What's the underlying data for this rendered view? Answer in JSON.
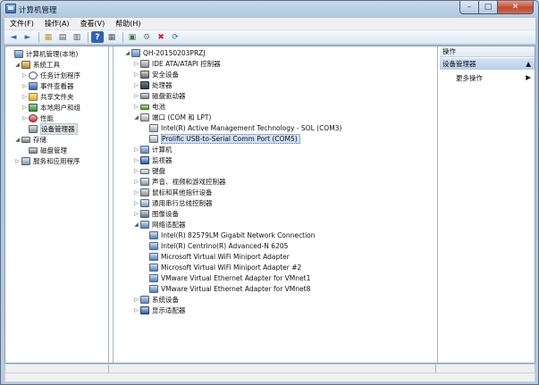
{
  "window": {
    "title": "计算机管理",
    "min": "–",
    "max": "□",
    "close": "✕"
  },
  "menu": [
    "文件(F)",
    "操作(A)",
    "查看(V)",
    "帮助(H)"
  ],
  "toolbar": [
    "◄",
    "►",
    "▦",
    "▤",
    "▥",
    "?",
    "▦",
    "▣",
    "⚙",
    "✖",
    "⟳"
  ],
  "left_tree": [
    {
      "label": "计算机管理(本地)",
      "icon": "computer-icon",
      "exp": "",
      "indent": 0
    },
    {
      "label": "系统工具",
      "icon": "tools-icon",
      "exp": "◢",
      "indent": 1
    },
    {
      "label": "任务计划程序",
      "icon": "clock-icon",
      "exp": "▷",
      "indent": 2
    },
    {
      "label": "事件查看器",
      "icon": "book-icon",
      "exp": "▷",
      "indent": 2
    },
    {
      "label": "共享文件夹",
      "icon": "folder-icon",
      "exp": "▷",
      "indent": 2
    },
    {
      "label": "本地用户和组",
      "icon": "users-icon",
      "exp": "▷",
      "indent": 2
    },
    {
      "label": "性能",
      "icon": "performance-icon",
      "exp": "▷",
      "indent": 2
    },
    {
      "label": "设备管理器",
      "icon": "device-manager-icon",
      "exp": "",
      "indent": 2,
      "selected": true
    },
    {
      "label": "存储",
      "icon": "storage-icon",
      "exp": "◢",
      "indent": 1
    },
    {
      "label": "磁盘管理",
      "icon": "disk-icon",
      "exp": "",
      "indent": 2
    },
    {
      "label": "服务和应用程序",
      "icon": "services-icon",
      "exp": "▷",
      "indent": 1
    }
  ],
  "device_tree": [
    {
      "label": "QH-20150203PRZJ",
      "icon": "computer-icon",
      "exp": "◢",
      "indent": 0
    },
    {
      "label": "IDE ATA/ATAPI 控制器",
      "icon": "ide-icon",
      "exp": "▷",
      "indent": 1
    },
    {
      "label": "安全设备",
      "icon": "security-icon",
      "exp": "▷",
      "indent": 1
    },
    {
      "label": "处理器",
      "icon": "processor-icon",
      "exp": "▷",
      "indent": 1
    },
    {
      "label": "磁盘驱动器",
      "icon": "disk-drive-icon",
      "exp": "▷",
      "indent": 1
    },
    {
      "label": "电池",
      "icon": "battery-icon",
      "exp": "▷",
      "indent": 1
    },
    {
      "label": "端口 (COM 和 LPT)",
      "icon": "port-icon",
      "exp": "◢",
      "indent": 1
    },
    {
      "label": "Intel(R) Active Management Technology - SOL (COM3)",
      "icon": "port-icon",
      "exp": "",
      "indent": 2
    },
    {
      "label": "Prolific USB-to-Serial Comm Port (COM5)",
      "icon": "port-icon",
      "exp": "",
      "indent": 2,
      "selected": true
    },
    {
      "label": "计算机",
      "icon": "computer-icon",
      "exp": "▷",
      "indent": 1
    },
    {
      "label": "监视器",
      "icon": "monitor-icon",
      "exp": "▷",
      "indent": 1
    },
    {
      "label": "键盘",
      "icon": "keyboard-icon",
      "exp": "▷",
      "indent": 1
    },
    {
      "label": "声音、视频和游戏控制器",
      "icon": "sound-icon",
      "exp": "▷",
      "indent": 1
    },
    {
      "label": "鼠标和其他指针设备",
      "icon": "mouse-icon",
      "exp": "▷",
      "indent": 1
    },
    {
      "label": "通用串行总线控制器",
      "icon": "usb-icon",
      "exp": "▷",
      "indent": 1
    },
    {
      "label": "图像设备",
      "icon": "imaging-icon",
      "exp": "▷",
      "indent": 1
    },
    {
      "label": "网络适配器",
      "icon": "network-icon",
      "exp": "◢",
      "indent": 1
    },
    {
      "label": "Intel(R) 82579LM Gigabit Network Connection",
      "icon": "network-icon",
      "exp": "",
      "indent": 2
    },
    {
      "label": "Intel(R) Centrino(R) Advanced-N 6205",
      "icon": "network-icon",
      "exp": "",
      "indent": 2
    },
    {
      "label": "Microsoft Virtual WiFi Miniport Adapter",
      "icon": "network-icon",
      "exp": "",
      "indent": 2
    },
    {
      "label": "Microsoft Virtual WiFi Miniport Adapter #2",
      "icon": "network-icon",
      "exp": "",
      "indent": 2
    },
    {
      "label": "VMware Virtual Ethernet Adapter for VMnet1",
      "icon": "network-icon",
      "exp": "",
      "indent": 2
    },
    {
      "label": "VMware Virtual Ethernet Adapter for VMnet8",
      "icon": "network-icon",
      "exp": "",
      "indent": 2
    },
    {
      "label": "系统设备",
      "icon": "system-devices-icon",
      "exp": "▷",
      "indent": 1
    },
    {
      "label": "显示适配器",
      "icon": "display-adapter-icon",
      "exp": "▷",
      "indent": 1
    }
  ],
  "actions": {
    "header": "操作",
    "section": "设备管理器",
    "section_arrow": "▲",
    "more": "更多操作",
    "more_arrow": "▶"
  }
}
